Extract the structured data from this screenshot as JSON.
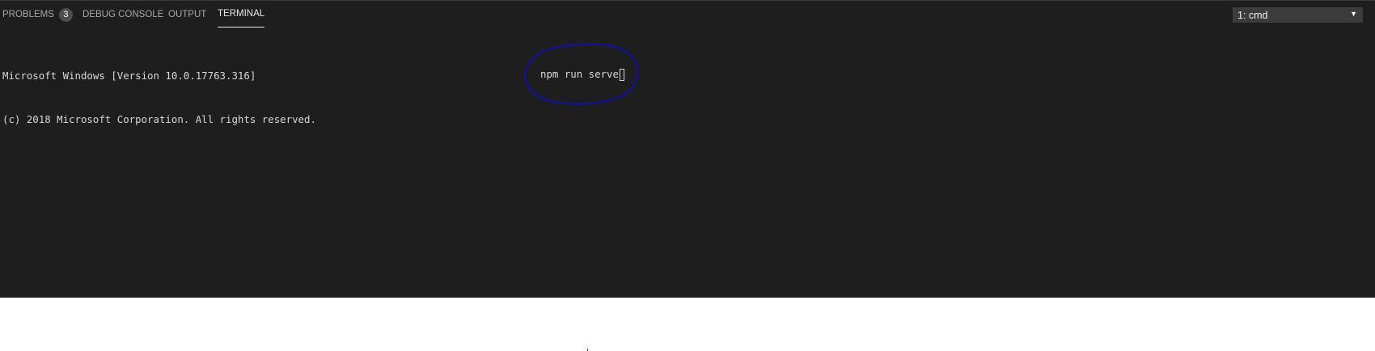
{
  "panel": {
    "tabs": [
      {
        "label": "PROBLEMS",
        "badge": "3"
      },
      {
        "label": "DEBUG CONSOLE"
      },
      {
        "label": "OUTPUT"
      },
      {
        "label": "TERMINAL",
        "active": true
      }
    ],
    "terminal_selector": {
      "value": "1: cmd"
    }
  },
  "terminal": {
    "lines": [
      "Microsoft Windows [Version 10.0.17763.316]",
      "(c) 2018 Microsoft Corporation. All rights reserved."
    ],
    "command": "npm run serve"
  },
  "colors": {
    "panel_bg": "#1e1e1e",
    "annotation_circle": "#1010b0"
  }
}
